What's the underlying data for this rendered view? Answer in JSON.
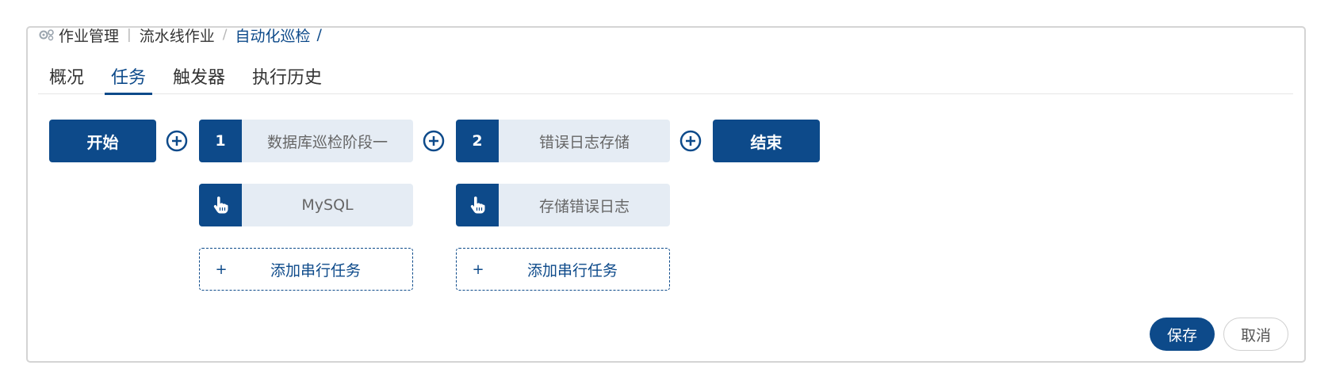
{
  "breadcrumb": {
    "icon": "gear-icon",
    "items": [
      "作业管理",
      "流水线作业",
      "自动化巡检"
    ],
    "trailing_separator": "/"
  },
  "tabs": [
    {
      "label": "概况",
      "active": false
    },
    {
      "label": "任务",
      "active": true
    },
    {
      "label": "触发器",
      "active": false
    },
    {
      "label": "执行历史",
      "active": false
    }
  ],
  "pipeline": {
    "start_label": "开始",
    "end_label": "结束",
    "stages": [
      {
        "number": "1",
        "name": "数据库巡检阶段一",
        "tasks": [
          {
            "icon": "hand-pointer-icon",
            "name": "MySQL"
          }
        ],
        "add_serial_label": "添加串行任务",
        "add_serial_plus": "+"
      },
      {
        "number": "2",
        "name": "错误日志存储",
        "tasks": [
          {
            "icon": "hand-pointer-icon",
            "name": "存储错误日志"
          }
        ],
        "add_serial_label": "添加串行任务",
        "add_serial_plus": "+"
      }
    ]
  },
  "footer": {
    "save_label": "保存",
    "cancel_label": "取消"
  },
  "colors": {
    "primary": "#0d4a8a",
    "stage_bg": "#e5ecf4",
    "border": "#d4d4d4"
  }
}
